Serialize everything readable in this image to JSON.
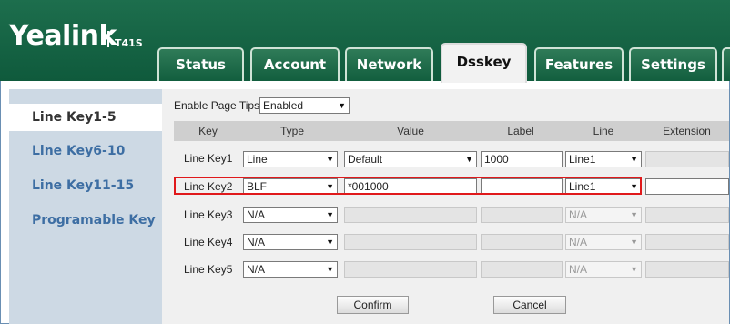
{
  "brand": {
    "logo": "Yealink",
    "model": "T41S"
  },
  "tabs": [
    {
      "label": "Status",
      "active": false
    },
    {
      "label": "Account",
      "active": false
    },
    {
      "label": "Network",
      "active": false
    },
    {
      "label": "Dsskey",
      "active": true
    },
    {
      "label": "Features",
      "active": false
    },
    {
      "label": "Settings",
      "active": false
    }
  ],
  "sidebar": {
    "items": [
      {
        "label": "Line Key1-5",
        "active": true
      },
      {
        "label": "Line Key6-10",
        "active": false
      },
      {
        "label": "Line Key11-15",
        "active": false
      },
      {
        "label": "Programable Key",
        "active": false
      }
    ]
  },
  "page_tips": {
    "label": "Enable Page Tips",
    "value": "Enabled"
  },
  "table": {
    "headers": [
      "Key",
      "Type",
      "Value",
      "Label",
      "Line",
      "Extension"
    ],
    "rows": [
      {
        "key": "Line Key1",
        "type": "Line",
        "value": "Default",
        "label": "1000",
        "line": "Line1",
        "extension": ""
      },
      {
        "key": "Line Key2",
        "type": "BLF",
        "value": "*001000",
        "label": "",
        "line": "Line1",
        "extension": ""
      },
      {
        "key": "Line Key3",
        "type": "N/A",
        "value": "",
        "label": "",
        "line": "N/A",
        "extension": ""
      },
      {
        "key": "Line Key4",
        "type": "N/A",
        "value": "",
        "label": "",
        "line": "N/A",
        "extension": ""
      },
      {
        "key": "Line Key5",
        "type": "N/A",
        "value": "",
        "label": "",
        "line": "N/A",
        "extension": ""
      }
    ]
  },
  "actions": {
    "confirm": "Confirm",
    "cancel": "Cancel"
  },
  "colors": {
    "header_green": "#0f5a3c",
    "sidebar_link": "#3d6ea3",
    "highlight_red": "#e0191b"
  }
}
